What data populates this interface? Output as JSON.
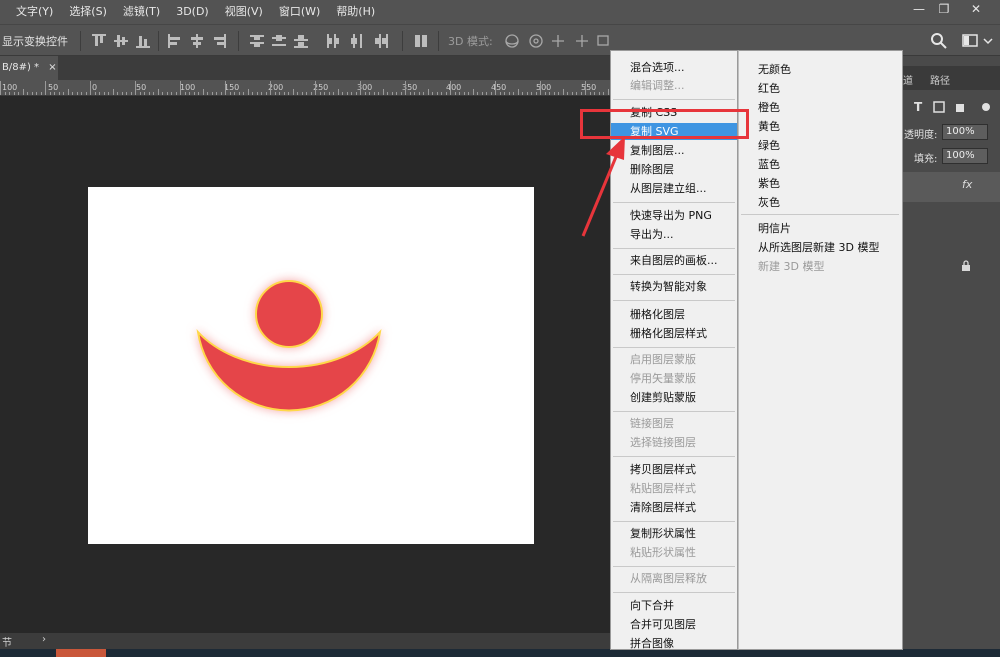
{
  "menubar": {
    "items": [
      "文字(Y)",
      "选择(S)",
      "滤镜(T)",
      "3D(D)",
      "视图(V)",
      "窗口(W)",
      "帮助(H)"
    ],
    "window_controls": [
      "—",
      "❐",
      "✕"
    ]
  },
  "options_bar": {
    "show_transform_controls": "显示变换控件",
    "mode_3d_label": "3D 模式:"
  },
  "document": {
    "tab_label": "B/8#) *",
    "tab_close": "×",
    "canvas_bg": "#ffffff",
    "shape_color": "#e54548",
    "glow_color": "#ffd84a"
  },
  "ruler": {
    "labels": [
      "100",
      "50",
      "0",
      "50",
      "100",
      "150",
      "200",
      "250",
      "300",
      "350",
      "400",
      "450",
      "500",
      "550"
    ]
  },
  "status_bar": {
    "text": "节",
    "chevron": "›"
  },
  "right_panel": {
    "tab_paths_partial": "道",
    "tab_paths": "路径",
    "opacity_label": "透明度:",
    "opacity_value": "100%",
    "fill_label": "填充:",
    "fill_value": "100%",
    "fx_label": "fx"
  },
  "context_menu": {
    "items": [
      {
        "label": "混合选项...",
        "disabled": false
      },
      {
        "label": "编辑调整...",
        "disabled": true
      },
      {
        "label": "复制 CSS",
        "disabled": false
      },
      {
        "label": "复制 SVG",
        "disabled": false,
        "highlighted": true
      },
      {
        "label": "复制图层...",
        "disabled": false
      },
      {
        "label": "删除图层",
        "disabled": false
      },
      {
        "label": "从图层建立组...",
        "disabled": false
      },
      {
        "label": "快速导出为 PNG",
        "disabled": false
      },
      {
        "label": "导出为...",
        "disabled": false
      },
      {
        "label": "来自图层的画板...",
        "disabled": false
      },
      {
        "label": "转换为智能对象",
        "disabled": false
      },
      {
        "label": "栅格化图层",
        "disabled": false
      },
      {
        "label": "栅格化图层样式",
        "disabled": false
      },
      {
        "label": "启用图层蒙版",
        "disabled": true
      },
      {
        "label": "停用矢量蒙版",
        "disabled": true
      },
      {
        "label": "创建剪贴蒙版",
        "disabled": false
      },
      {
        "label": "链接图层",
        "disabled": true
      },
      {
        "label": "选择链接图层",
        "disabled": true
      },
      {
        "label": "拷贝图层样式",
        "disabled": false
      },
      {
        "label": "粘贴图层样式",
        "disabled": true
      },
      {
        "label": "清除图层样式",
        "disabled": false
      },
      {
        "label": "复制形状属性",
        "disabled": false
      },
      {
        "label": "粘贴形状属性",
        "disabled": true
      },
      {
        "label": "从隔离图层释放",
        "disabled": true
      },
      {
        "label": "向下合并",
        "disabled": false
      },
      {
        "label": "合并可见图层",
        "disabled": false
      },
      {
        "label": "拼合图像",
        "disabled": false
      }
    ],
    "color_items": [
      {
        "label": "无颜色",
        "disabled": false
      },
      {
        "label": "红色",
        "disabled": false
      },
      {
        "label": "橙色",
        "disabled": false
      },
      {
        "label": "黄色",
        "disabled": false
      },
      {
        "label": "绿色",
        "disabled": false
      },
      {
        "label": "蓝色",
        "disabled": false
      },
      {
        "label": "紫色",
        "disabled": false
      },
      {
        "label": "灰色",
        "disabled": false
      },
      {
        "label": "明信片",
        "disabled": false
      },
      {
        "label": "从所选图层新建 3D 模型",
        "disabled": false
      },
      {
        "label": "新建 3D 模型",
        "disabled": true
      }
    ]
  },
  "annotation": {
    "highlight_color": "#e7353b"
  }
}
